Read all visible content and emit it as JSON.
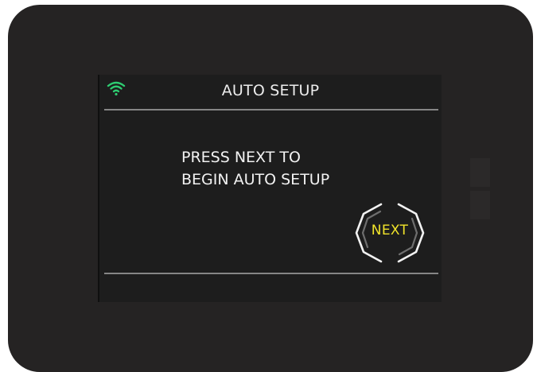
{
  "screen": {
    "title": "AUTO SETUP",
    "message_line1": "PRESS NEXT TO",
    "message_line2": "BEGIN AUTO SETUP",
    "next_label": "NEXT"
  },
  "status": {
    "wifi_icon": "wifi-icon",
    "wifi_color": "#2ecc71"
  },
  "colors": {
    "bezel": "#252323",
    "screen_bg": "#1d1d1d",
    "text": "#ececec",
    "accent_yellow": "#f0e32a"
  }
}
